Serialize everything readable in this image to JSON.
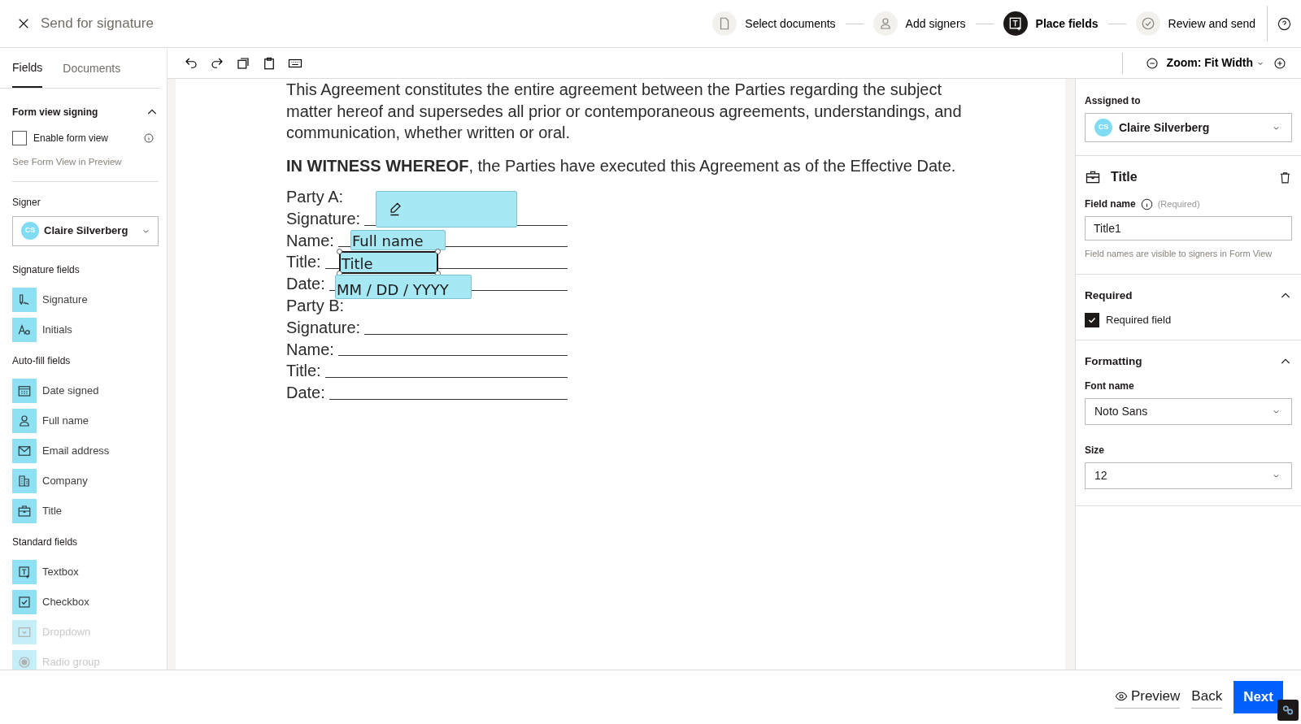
{
  "header": {
    "title": "Send for signature",
    "steps": [
      {
        "label": "Select documents",
        "kind": "document",
        "selected": false
      },
      {
        "label": "Add signers",
        "kind": "person",
        "selected": false
      },
      {
        "label": "Place fields",
        "kind": "textbox",
        "selected": true
      },
      {
        "label": "Review and send",
        "kind": "check",
        "selected": false
      }
    ]
  },
  "sidebar": {
    "tabs": [
      {
        "label": "Fields",
        "selected": true
      },
      {
        "label": "Documents",
        "selected": false
      }
    ],
    "form_view": {
      "heading": "Form view signing",
      "expanded": true,
      "checkbox": {
        "label": "Enable form view",
        "checked": false
      },
      "link": "See Form View in Preview"
    },
    "signer": {
      "label": "Signer",
      "initials": "CS",
      "value": "Claire Silverberg"
    },
    "groups": [
      {
        "heading": "Signature fields",
        "items": [
          {
            "label": "Signature",
            "kind": "signature",
            "disabled": false
          },
          {
            "label": "Initials",
            "kind": "initials",
            "disabled": false
          }
        ]
      },
      {
        "heading": "Auto-fill fields",
        "items": [
          {
            "label": "Date signed",
            "kind": "calendar",
            "disabled": false
          },
          {
            "label": "Full name",
            "kind": "person",
            "disabled": false
          },
          {
            "label": "Email address",
            "kind": "envelope",
            "disabled": false
          },
          {
            "label": "Company",
            "kind": "building",
            "disabled": false
          },
          {
            "label": "Title",
            "kind": "briefcase",
            "disabled": false
          }
        ]
      },
      {
        "heading": "Standard fields",
        "items": [
          {
            "label": "Textbox",
            "kind": "textbox",
            "disabled": false
          },
          {
            "label": "Checkbox",
            "kind": "checkbox",
            "disabled": false
          },
          {
            "label": "Dropdown",
            "kind": "dropdown",
            "disabled": true
          },
          {
            "label": "Radio group",
            "kind": "radio",
            "disabled": true
          }
        ]
      }
    ]
  },
  "toolbar": {
    "zoom": "Zoom: Fit Width"
  },
  "document": {
    "paragraphs": [
      "This Agreement constitutes the entire agreement between the Parties regarding the subject matter hereof and supersedes all prior or contemporaneous agreements, understandings, and communication, whether written or oral.",
      "**IN WITNESS WHEREOF**, the Parties have executed this Agreement as of the Effective Date."
    ],
    "lines": [
      {
        "label": "Party A:",
        "blank": false
      },
      {
        "label": "Signature:",
        "blank": true
      },
      {
        "label": "Name:",
        "blank": true
      },
      {
        "label": "Title:",
        "blank": true
      },
      {
        "label": "Date:",
        "blank": true
      },
      {
        "label": "Party B:",
        "blank": false
      },
      {
        "label": "Signature:",
        "blank": true
      },
      {
        "label": "Name:",
        "blank": true
      },
      {
        "label": "Title:",
        "blank": true
      },
      {
        "label": "Date:",
        "blank": true
      }
    ],
    "placed_fields": [
      {
        "kind": "signature",
        "selected": false
      },
      {
        "kind": "text",
        "text": "Full name",
        "selected": false
      },
      {
        "kind": "text",
        "text": "Title",
        "selected": true
      },
      {
        "kind": "text",
        "text": "MM / DD / YYYY",
        "selected": false
      }
    ]
  },
  "properties": {
    "assigned_to": {
      "label": "Assigned to",
      "initials": "CS",
      "value": "Claire Silverberg"
    },
    "field": {
      "title": "Title",
      "name_label": "Field name",
      "name_hint": "(Required)",
      "name_value": "Title1",
      "note": "Field names are visible to signers in Form View"
    },
    "required": {
      "heading": "Required",
      "expanded": true,
      "checkbox": {
        "label": "Required field",
        "checked": true
      }
    },
    "formatting": {
      "heading": "Formatting",
      "expanded": true,
      "font_label": "Font name",
      "font_value": "Noto Sans",
      "size_label": "Size",
      "size_value": "12"
    }
  },
  "footer": {
    "preview": "Preview",
    "back": "Back",
    "next": "Next"
  }
}
